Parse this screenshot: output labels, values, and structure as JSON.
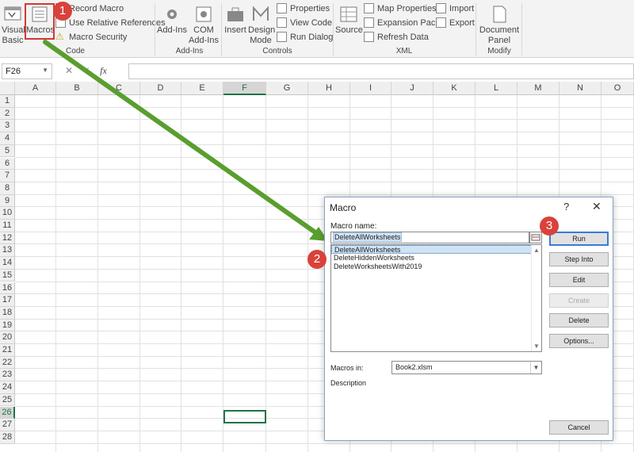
{
  "ribbon": {
    "visual_basic": "Visual\nBasic",
    "macros": "Macros",
    "record_macro": "Record Macro",
    "relative_refs": "Use Relative References",
    "macro_security": "Macro Security",
    "group_code": "Code",
    "addins": "Add-Ins",
    "com_addins": "COM\nAdd-Ins",
    "group_addins": "Add-Ins",
    "insert": "Insert",
    "design_mode": "Design\nMode",
    "properties": "Properties",
    "view_code": "View Code",
    "run_dialog": "Run Dialog",
    "group_controls": "Controls",
    "source": "Source",
    "map_properties": "Map Properties",
    "expansion_packs": "Expansion Packs",
    "refresh_data": "Refresh Data",
    "import": "Import",
    "export": "Export",
    "group_xml": "XML",
    "document_panel": "Document\nPanel",
    "group_modify": "Modify"
  },
  "formula_bar": {
    "name_box": "F26",
    "fx": "fx",
    "cancel": "✕",
    "enter": "✓"
  },
  "grid": {
    "columns": [
      "A",
      "B",
      "C",
      "D",
      "E",
      "F",
      "G",
      "H",
      "I",
      "J",
      "K",
      "L",
      "M",
      "N",
      "O"
    ],
    "rows": [
      "1",
      "2",
      "3",
      "4",
      "5",
      "6",
      "7",
      "8",
      "9",
      "10",
      "11",
      "12",
      "13",
      "14",
      "15",
      "16",
      "17",
      "18",
      "19",
      "20",
      "21",
      "22",
      "23",
      "24",
      "25",
      "26",
      "27",
      "28"
    ],
    "selected_column": "F",
    "selected_row": "26"
  },
  "dialog": {
    "title": "Macro",
    "help": "?",
    "close": "✕",
    "macro_name_label": "Macro name:",
    "macro_name_value": "DeleteAllWorksheets",
    "macros": [
      "DeleteAllWorksheets",
      "DeleteHiddenWorksheets",
      "DeleteWorksheetsWith2019"
    ],
    "buttons": {
      "run": "Run",
      "step_into": "Step Into",
      "edit": "Edit",
      "create": "Create",
      "delete": "Delete",
      "options": "Options...",
      "cancel": "Cancel"
    },
    "macros_in_label": "Macros in:",
    "macros_in_value": "Book2.xlsm",
    "description_label": "Description"
  },
  "annotations": {
    "step1": "1",
    "step2": "2",
    "step3": "3",
    "highlight_color": "#d03a34",
    "arrow_color": "#5a9e2f"
  }
}
